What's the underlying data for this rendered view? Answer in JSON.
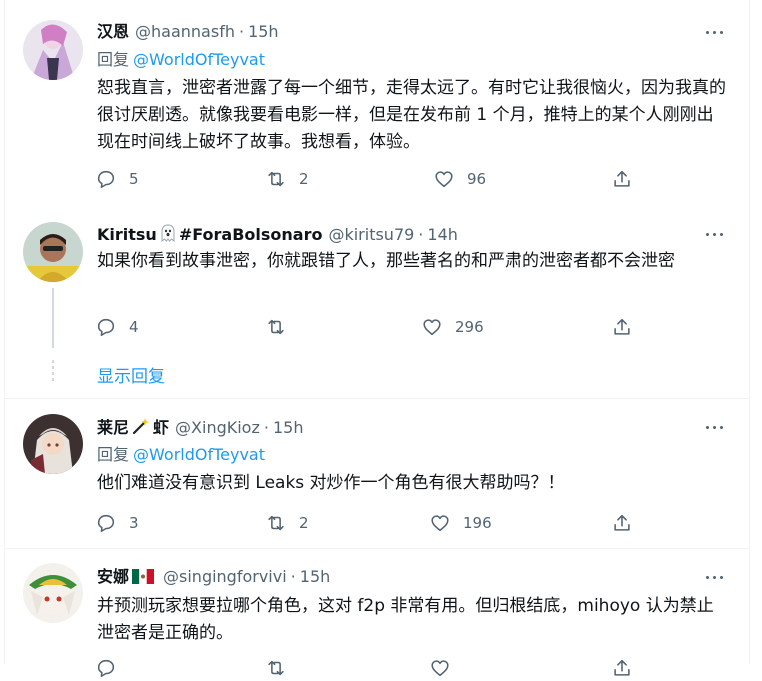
{
  "tweets": [
    {
      "name": "汉恩",
      "handle": "@haannasfh",
      "time": "15h",
      "reply_label": "回复",
      "reply_to": "@WorldOfTeyvat",
      "text": "恕我直言，泄密者泄露了每一个细节，走得太远了。有时它让我很恼火，因为我真的很讨厌剧透。就像我要看电影一样，但是在发布前 1 个月，推特上的某个人刚刚出现在时间线上破坏了故事。我想看，体验。",
      "replies": "5",
      "retweets": "2",
      "likes": "96"
    },
    {
      "name": "Kiritsu",
      "name_suffix": "#ForaBolsonaro",
      "emoji": "ghost-emoji",
      "handle": "@kiritsu79",
      "time": "14h",
      "text": "如果你看到故事泄密，你就跟错了人，那些著名的和严肃的泄密者都不会泄密",
      "replies": "4",
      "retweets": "",
      "likes": "296"
    },
    {
      "name": "莱尼",
      "name_suffix": "虾",
      "emoji": "magic-wand-emoji",
      "handle": "@XingKioz",
      "time": "15h",
      "reply_label": "回复",
      "reply_to": "@WorldOfTeyvat",
      "text": "他们难道没有意识到 Leaks 对炒作一个角色有很大帮助吗？！",
      "replies": "3",
      "retweets": "2",
      "likes": "196"
    },
    {
      "name": "安娜",
      "emoji": "mexico-flag-emoji",
      "handle": "@singingforvivi",
      "time": "15h",
      "text": "并预测玩家想要拉哪个角色，这对 f2p 非常有用。但归根结底，mihoyo 认为禁止泄密者是正确的。"
    }
  ],
  "show_replies": "显示回复",
  "colors": {
    "accent": "#1d9bf0",
    "secondary": "#536471",
    "text": "#0f1419",
    "border": "#eff3f4"
  }
}
